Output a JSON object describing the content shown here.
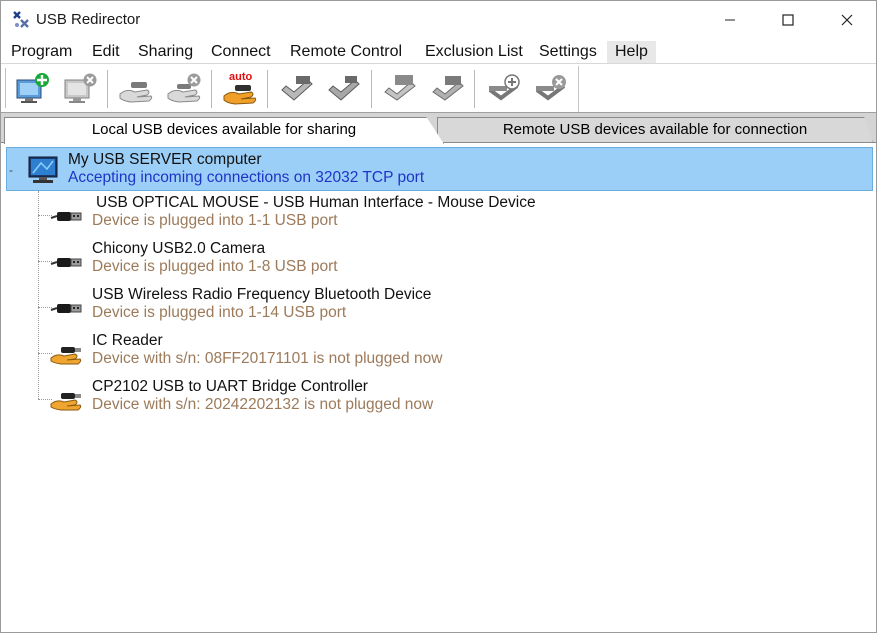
{
  "window": {
    "title": "USB Redirector",
    "controls": [
      "minimize-icon",
      "maximize-icon",
      "close-icon"
    ]
  },
  "menu": {
    "items": [
      "Program",
      "Edit",
      "Sharing",
      "Connect",
      "Remote Control",
      "Exclusion List",
      "Settings",
      "Help"
    ]
  },
  "toolbar": {
    "buttons": [
      "add-server-icon",
      "remove-server-icon",
      "share-device-icon",
      "unshare-device-icon",
      "auto-share-icon",
      "connect-device-icon",
      "disconnect-device-icon",
      "connect-remote-icon",
      "disconnect-remote-icon",
      "add-exclusion-icon",
      "remove-exclusion-icon"
    ],
    "auto_label": "auto"
  },
  "tabs": {
    "local": "Local USB devices available for sharing",
    "remote": "Remote USB devices available for connection"
  },
  "server": {
    "expander": "-",
    "name": "My USB SERVER computer",
    "status": "Accepting incoming connections on 32032 TCP port"
  },
  "devices": [
    {
      "name": " USB OPTICAL MOUSE - USB Human Interface - Mouse Device",
      "status": "Device is plugged into 1-1 USB port",
      "icon": "usb-plug-icon"
    },
    {
      "name": "Chicony USB2.0 Camera",
      "status": "Device is plugged into 1-8 USB port",
      "icon": "usb-plug-icon"
    },
    {
      "name": "USB Wireless Radio Frequency Bluetooth Device",
      "status": "Device is plugged into 1-14 USB port",
      "icon": "usb-plug-icon"
    },
    {
      "name": "IC Reader",
      "status": "Device with s/n: 08FF20171101 is not plugged now",
      "icon": "shared-hand-icon"
    },
    {
      "name": "CP2102 USB to UART Bridge Controller",
      "status": "Device with s/n: 20242202132 is not plugged now",
      "icon": "shared-hand-icon"
    }
  ],
  "colors": {
    "selection": "#9ccff7",
    "server_status": "#1e34c8",
    "device_status": "#9c7a5a"
  }
}
